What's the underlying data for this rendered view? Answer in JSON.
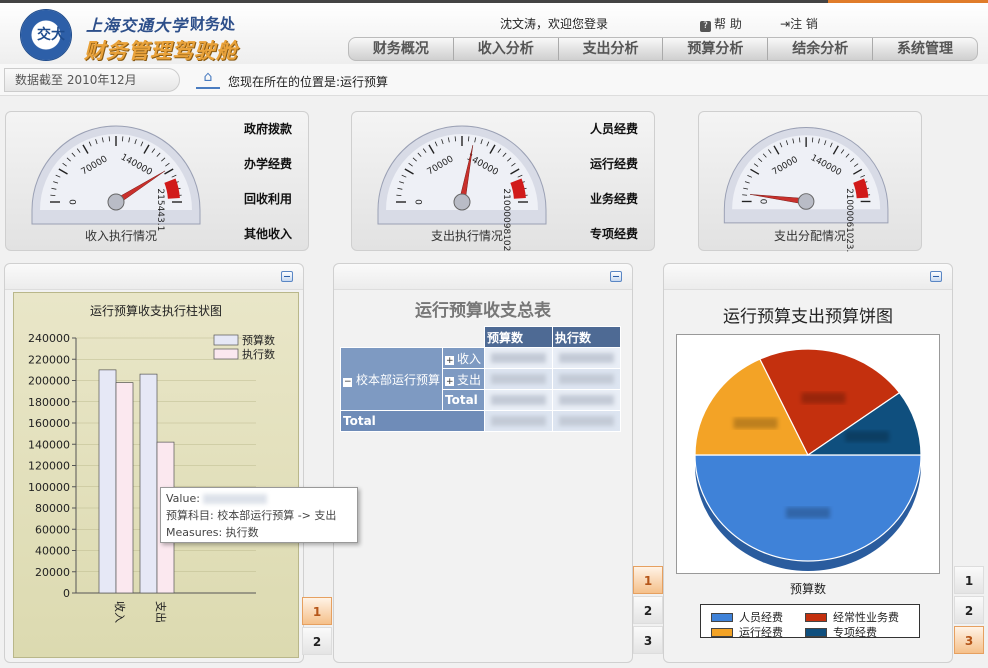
{
  "header": {
    "brand_university": "上海交通大学",
    "brand_dept": "财务处",
    "brand_system": "财务管理驾驶舱",
    "logo_text": "交大",
    "welcome": "沈文涛，欢迎您登录",
    "help_label": "帮 助",
    "logout_label": "注 销"
  },
  "menu": [
    "财务概况",
    "收入分析",
    "支出分析",
    "预算分析",
    "结余分析",
    "系统管理"
  ],
  "crumbbar": {
    "date_label": "数据截至 2010年12月",
    "location": "您现在所在的位置是:运行预算"
  },
  "gauges": [
    {
      "title": "收入执行情况",
      "ticks": [
        "0",
        "70000",
        "140000"
      ],
      "max_label": "215443.1",
      "needle_fraction": 0.82,
      "labels": [
        "政府拨款",
        "办学经费",
        "回收利用",
        "其他收入"
      ]
    },
    {
      "title": "支出执行情况",
      "ticks": [
        "0",
        "70000",
        "140000"
      ],
      "max_label": "210000981023.0",
      "needle_fraction": 0.56,
      "labels": [
        "人员经费",
        "运行经费",
        "业务经费",
        "专项经费"
      ]
    },
    {
      "title": "支出分配情况",
      "ticks": [
        "0",
        "70000",
        "140000"
      ],
      "max_label": "21000061023.0",
      "needle_fraction": 0.04,
      "labels": []
    }
  ],
  "bar_panel": {
    "pagers": [
      "1",
      "2"
    ],
    "active_pager": "1",
    "tooltip": {
      "value_label": "Value:",
      "subject": "预算科目: 校本部运行预算 -> 支出",
      "measures": "Measures: 执行数"
    }
  },
  "chart_data": {
    "type": "bar",
    "title": "运行预算收支执行柱状图",
    "categories": [
      "收入",
      "支出"
    ],
    "series": [
      {
        "name": "预算数",
        "values": [
          210000,
          206000
        ],
        "color": "#e6e8f6"
      },
      {
        "name": "执行数",
        "values": [
          198000,
          142000
        ],
        "color": "#fbe8ef"
      }
    ],
    "ylim": [
      0,
      240000
    ],
    "yticks": [
      "0",
      "20000",
      "40000",
      "60000",
      "80000",
      "100000",
      "120000",
      "140000",
      "160000",
      "180000",
      "200000",
      "220000",
      "240000"
    ],
    "legend_position": "top-right",
    "grid": true
  },
  "table_panel": {
    "title": "运行预算收支总表",
    "col_budget": "预算数",
    "col_actual": "执行数",
    "group": "校本部运行预算",
    "row_income": "收入",
    "row_expense": "支出",
    "row_total": "Total",
    "grand_total": "Total",
    "pagers": [
      "1",
      "2",
      "3"
    ],
    "active_pager": "1"
  },
  "pie_panel": {
    "title": "运行预算支出预算饼图",
    "subtitle": "预算数",
    "slices": [
      {
        "name": "人员经费",
        "fraction": 0.5,
        "color": "#3f82d8"
      },
      {
        "name": "运行经费",
        "fraction": 0.18,
        "color": "#f3a326"
      },
      {
        "name": "经常性业务费",
        "fraction": 0.22,
        "color": "#c4300e"
      },
      {
        "name": "专项经费",
        "fraction": 0.1,
        "color": "#0f4f7e"
      }
    ],
    "legend": [
      "人员经费",
      "经常性业务费",
      "运行经费",
      "专项经费"
    ],
    "pagers": [
      "1",
      "2",
      "3"
    ],
    "active_pager": "3"
  }
}
